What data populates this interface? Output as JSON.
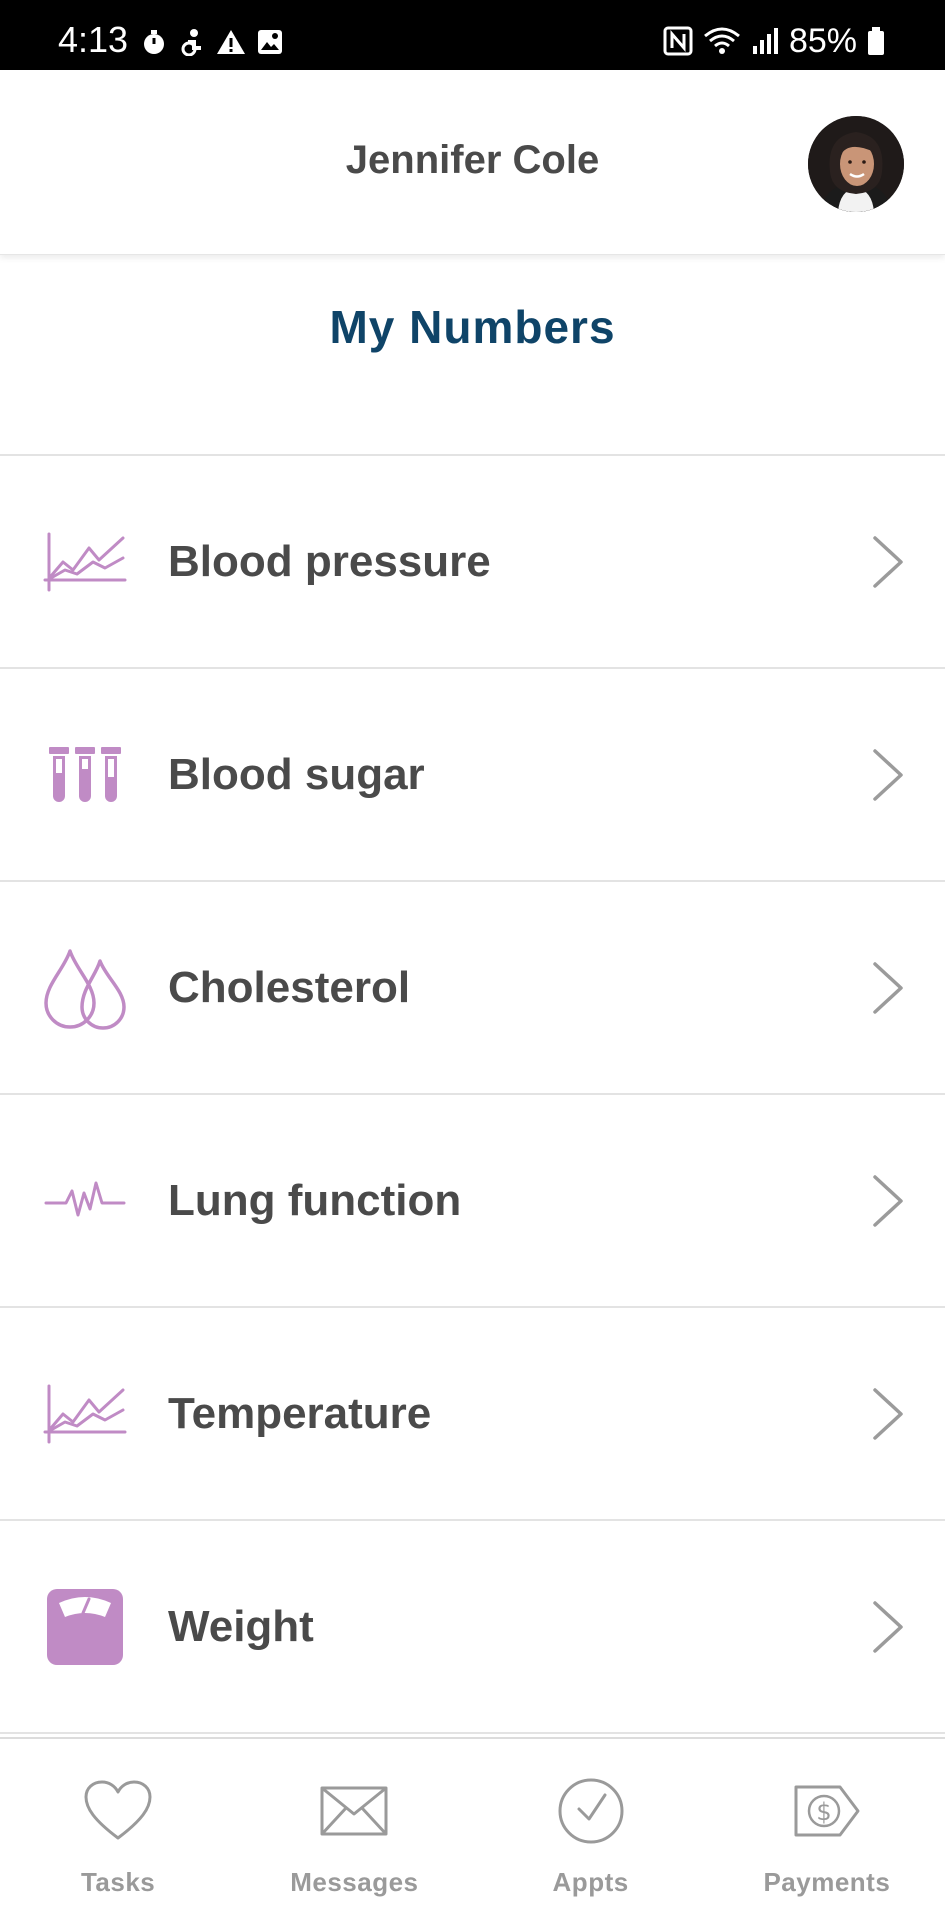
{
  "status_bar": {
    "time": "4:13",
    "battery": "85%",
    "icons": [
      "timer-icon",
      "accessibility-icon",
      "warning-icon",
      "image-icon",
      "nfc-icon",
      "wifi-icon",
      "signal-icon",
      "battery-icon"
    ]
  },
  "header": {
    "user_name": "Jennifer Cole"
  },
  "page": {
    "title": "My Numbers"
  },
  "accent_color": "#c08bc5",
  "title_color": "#0f4468",
  "items": [
    {
      "label": "Blood pressure",
      "icon": "line-chart-icon"
    },
    {
      "label": "Blood sugar",
      "icon": "test-tubes-icon"
    },
    {
      "label": "Cholesterol",
      "icon": "drops-icon"
    },
    {
      "label": "Lung function",
      "icon": "pulse-icon"
    },
    {
      "label": "Temperature",
      "icon": "line-chart-icon"
    },
    {
      "label": "Weight",
      "icon": "scale-icon"
    }
  ],
  "tabs": [
    {
      "label": "Tasks",
      "icon": "heart-icon"
    },
    {
      "label": "Messages",
      "icon": "envelope-icon"
    },
    {
      "label": "Appts",
      "icon": "clock-icon"
    },
    {
      "label": "Payments",
      "icon": "dollar-tag-icon"
    }
  ]
}
